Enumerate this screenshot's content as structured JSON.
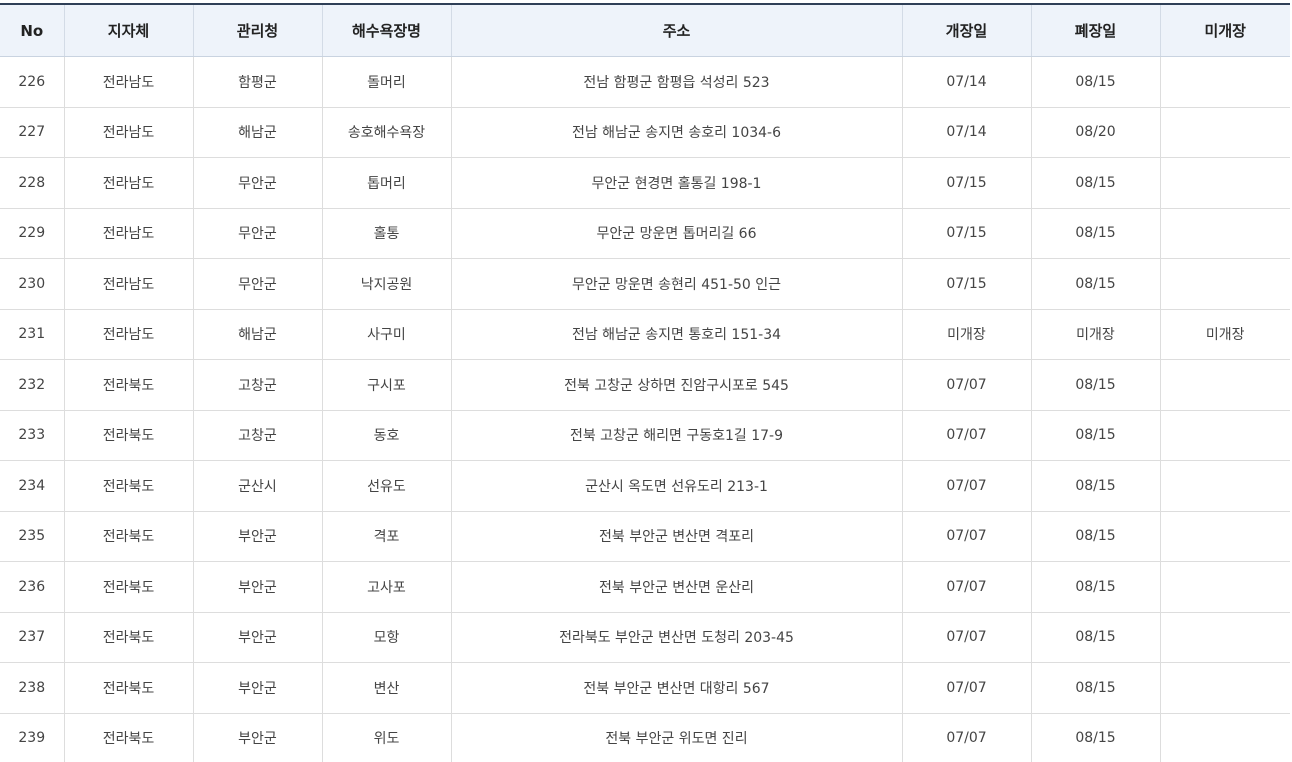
{
  "table": {
    "headers": [
      "No",
      "지자체",
      "관리청",
      "해수욕장명",
      "주소",
      "개장일",
      "폐장일",
      "미개장"
    ],
    "rows": [
      [
        "226",
        "전라남도",
        "함평군",
        "돌머리",
        "전남 함평군 함평읍 석성리 523",
        "07/14",
        "08/15",
        ""
      ],
      [
        "227",
        "전라남도",
        "해남군",
        "송호해수욕장",
        "전남 해남군 송지면 송호리 1034-6",
        "07/14",
        "08/20",
        ""
      ],
      [
        "228",
        "전라남도",
        "무안군",
        "톱머리",
        "무안군 현경면 홀통길 198-1",
        "07/15",
        "08/15",
        ""
      ],
      [
        "229",
        "전라남도",
        "무안군",
        "홀통",
        "무안군 망운면 톱머리길 66",
        "07/15",
        "08/15",
        ""
      ],
      [
        "230",
        "전라남도",
        "무안군",
        "낙지공원",
        "무안군 망운면 송현리 451-50 인근",
        "07/15",
        "08/15",
        ""
      ],
      [
        "231",
        "전라남도",
        "해남군",
        "사구미",
        "전남 해남군 송지면 통호리 151-34",
        "미개장",
        "미개장",
        "미개장"
      ],
      [
        "232",
        "전라북도",
        "고창군",
        "구시포",
        "전북 고창군 상하면 진암구시포로 545",
        "07/07",
        "08/15",
        ""
      ],
      [
        "233",
        "전라북도",
        "고창군",
        "동호",
        "전북 고창군 해리면 구동호1길 17-9",
        "07/07",
        "08/15",
        ""
      ],
      [
        "234",
        "전라북도",
        "군산시",
        "선유도",
        "군산시 옥도면 선유도리 213-1",
        "07/07",
        "08/15",
        ""
      ],
      [
        "235",
        "전라북도",
        "부안군",
        "격포",
        "전북 부안군 변산면 격포리",
        "07/07",
        "08/15",
        ""
      ],
      [
        "236",
        "전라북도",
        "부안군",
        "고사포",
        "전북 부안군 변산면 운산리",
        "07/07",
        "08/15",
        ""
      ],
      [
        "237",
        "전라북도",
        "부안군",
        "모항",
        "전라북도 부안군 변산면 도청리 203-45",
        "07/07",
        "08/15",
        ""
      ],
      [
        "238",
        "전라북도",
        "부안군",
        "변산",
        "전북 부안군 변산면 대항리 567",
        "07/07",
        "08/15",
        ""
      ],
      [
        "239",
        "전라북도",
        "부안군",
        "위도",
        "전북 부안군 위도면 진리",
        "07/07",
        "08/15",
        ""
      ]
    ]
  }
}
